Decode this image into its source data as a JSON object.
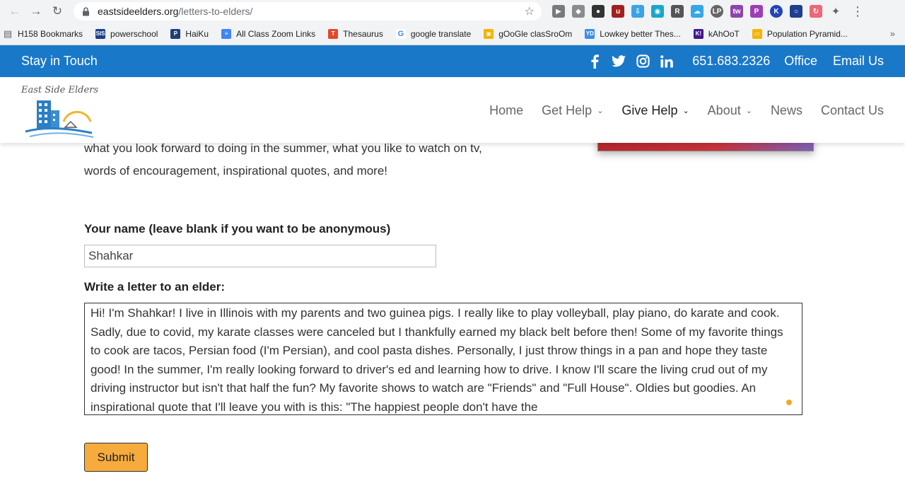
{
  "browser": {
    "url_domain": "eastsideelders.org",
    "url_path": "/letters-to-elders/",
    "bookmarks": [
      {
        "label": "H158 Bookmarks",
        "icon": "folder-icon",
        "color": "#5f6368"
      },
      {
        "label": "powerschool",
        "icon": "sis-icon",
        "color": "#1d3f8a",
        "badge": "SIS"
      },
      {
        "label": "HaiKu",
        "icon": "haiku-icon",
        "color": "#1f3d7a",
        "badge": "P"
      },
      {
        "label": "All Class Zoom Links",
        "icon": "docs-icon",
        "color": "#4285f4",
        "badge": "≡"
      },
      {
        "label": "Thesaurus",
        "icon": "thesaurus-icon",
        "color": "#e24a2b",
        "badge": "T"
      },
      {
        "label": "google translate",
        "icon": "google-icon",
        "color": "#ffffff",
        "badge": "G"
      },
      {
        "label": "gOoGle clasSroOm",
        "icon": "classroom-icon",
        "color": "#f4b400",
        "badge": "▣"
      },
      {
        "label": "Lowkey better Thes...",
        "icon": "yd-icon",
        "color": "#3b8ee8",
        "badge": "YD"
      },
      {
        "label": "kAhOoT",
        "icon": "kahoot-icon",
        "color": "#46178f",
        "badge": "K!"
      },
      {
        "label": "Population Pyramid...",
        "icon": "slides-icon",
        "color": "#f4b400",
        "badge": "▭"
      }
    ]
  },
  "topbar": {
    "stay": "Stay in Touch",
    "phone": "651.683.2326",
    "office": "Office",
    "email": "Email Us"
  },
  "logo": {
    "text": "East Side Elders"
  },
  "nav": {
    "home": "Home",
    "get_help": "Get Help",
    "give_help": "Give Help",
    "about": "About",
    "news": "News",
    "contact": "Contact Us"
  },
  "content": {
    "cut_line": "what you look forward to doing in the summer, what you like to watch on tv,",
    "line2": "words of encouragement, inspirational quotes, and more!",
    "name_label": "Your name (leave blank if you want to be anonymous)",
    "name_value": "Shahkar",
    "letter_label": "Write a letter to an elder:",
    "letter_value": "Hi! I'm Shahkar! I live in Illinois with my parents and two guinea pigs. I really like to play volleyball, play piano, do karate and cook. Sadly, due to covid, my karate classes were canceled but I thankfully earned my black belt before then! Some of my favorite things to cook are tacos, Persian food (I'm Persian), and cool pasta dishes. Personally, I just throw things in a pan and hope they taste good! In the summer, I'm really looking forward to driver's ed and learning how to drive. I know I'll scare the living crud out of my driving instructor but isn't that half the fun? My favorite shows to watch are \"Friends\" and \"Full House\". Oldies but goodies. An inspirational quote that I'll leave you with is this: \"The happiest people don't have the",
    "submit": "Submit"
  },
  "colors": {
    "brand_blue": "#1a78c9",
    "submit_orange": "#f6ab3c"
  }
}
